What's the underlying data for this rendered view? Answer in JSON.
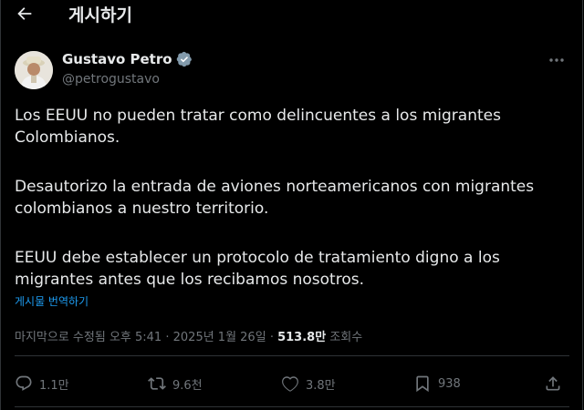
{
  "header": {
    "title": "게시하기",
    "back_icon": "arrow-left-icon"
  },
  "author": {
    "name": "Gustavo Petro",
    "handle": "@petrogustavo",
    "verified_icon": "verified-badge-icon",
    "avatar_icon": "profile-avatar"
  },
  "more_icon": "more-horizontal-icon",
  "tweet": {
    "paragraphs": [
      "Los EEUU no pueden tratar como delincuentes a los migrantes Colombianos.",
      "Desautorizo la entrada de aviones norteamericanos con migrantes colombianos a nuestro territorio.",
      "EEUU debe establecer un protocolo de tratamiento digno a los migrantes antes que los recibamos nosotros."
    ]
  },
  "translate_label": "게시물 번역하기",
  "meta": {
    "edited": "마지막으로 수정됨 오후 5:41",
    "sep": "·",
    "date": "2025년 1월 26일",
    "views": "513.8만",
    "views_label": "조회수"
  },
  "actions": {
    "replies": {
      "icon": "reply-icon",
      "count": "1.1만"
    },
    "reposts": {
      "icon": "repost-icon",
      "count": "9.6천"
    },
    "likes": {
      "icon": "like-heart-icon",
      "count": "3.8만"
    },
    "bookmarks": {
      "icon": "bookmark-icon",
      "count": "938"
    },
    "share": {
      "icon": "share-icon"
    }
  },
  "colors": {
    "background": "#000000",
    "text": "#e7e9ea",
    "muted": "#71767b",
    "accent": "#1d9bf0",
    "border": "#2f3336"
  }
}
